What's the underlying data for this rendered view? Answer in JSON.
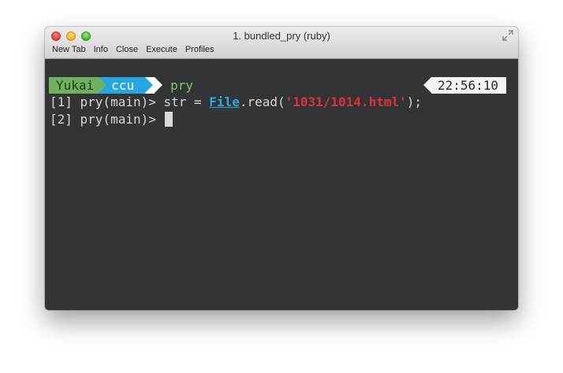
{
  "window": {
    "title": "1. bundled_pry (ruby)",
    "toolbar": [
      "New Tab",
      "Info",
      "Close",
      "Execute",
      "Profiles"
    ]
  },
  "prompt": {
    "user": "Yukai",
    "dir": "ccu",
    "app": "pry",
    "time": "22:56:10"
  },
  "lines": [
    {
      "prefix": "[1] pry(main)> ",
      "code_before": "str = ",
      "constant": "File",
      "code_mid": ".read(",
      "string": "'1031/1014.html'",
      "code_after": ");"
    },
    {
      "prefix": "[2] pry(main)> "
    }
  ],
  "colors": {
    "background": "#333435",
    "user_segment": "#6fb25e",
    "dir_segment": "#27a6e0",
    "constant": "#2fa8e0",
    "string": "#e0303a"
  }
}
